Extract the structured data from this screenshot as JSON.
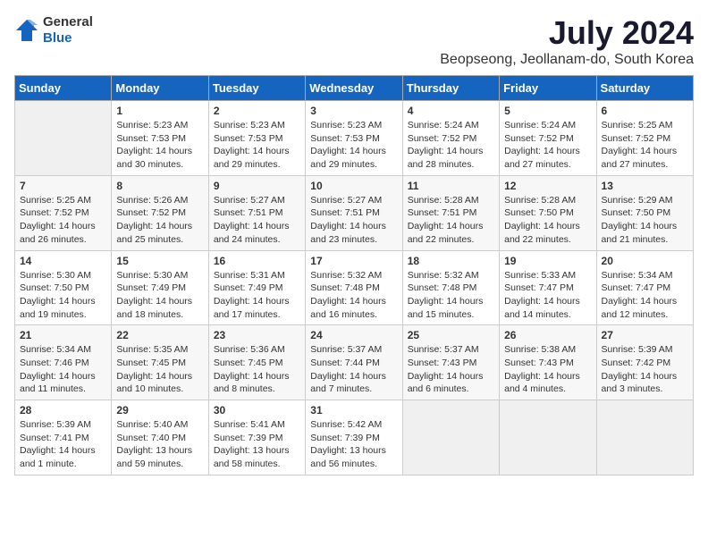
{
  "header": {
    "logo_general": "General",
    "logo_blue": "Blue",
    "month_title": "July 2024",
    "subtitle": "Beopseong, Jeollanam-do, South Korea"
  },
  "calendar": {
    "days_of_week": [
      "Sunday",
      "Monday",
      "Tuesday",
      "Wednesday",
      "Thursday",
      "Friday",
      "Saturday"
    ],
    "weeks": [
      [
        {
          "num": "",
          "info": ""
        },
        {
          "num": "1",
          "info": "Sunrise: 5:23 AM\nSunset: 7:53 PM\nDaylight: 14 hours\nand 30 minutes."
        },
        {
          "num": "2",
          "info": "Sunrise: 5:23 AM\nSunset: 7:53 PM\nDaylight: 14 hours\nand 29 minutes."
        },
        {
          "num": "3",
          "info": "Sunrise: 5:23 AM\nSunset: 7:53 PM\nDaylight: 14 hours\nand 29 minutes."
        },
        {
          "num": "4",
          "info": "Sunrise: 5:24 AM\nSunset: 7:52 PM\nDaylight: 14 hours\nand 28 minutes."
        },
        {
          "num": "5",
          "info": "Sunrise: 5:24 AM\nSunset: 7:52 PM\nDaylight: 14 hours\nand 27 minutes."
        },
        {
          "num": "6",
          "info": "Sunrise: 5:25 AM\nSunset: 7:52 PM\nDaylight: 14 hours\nand 27 minutes."
        }
      ],
      [
        {
          "num": "7",
          "info": "Sunrise: 5:25 AM\nSunset: 7:52 PM\nDaylight: 14 hours\nand 26 minutes."
        },
        {
          "num": "8",
          "info": "Sunrise: 5:26 AM\nSunset: 7:52 PM\nDaylight: 14 hours\nand 25 minutes."
        },
        {
          "num": "9",
          "info": "Sunrise: 5:27 AM\nSunset: 7:51 PM\nDaylight: 14 hours\nand 24 minutes."
        },
        {
          "num": "10",
          "info": "Sunrise: 5:27 AM\nSunset: 7:51 PM\nDaylight: 14 hours\nand 23 minutes."
        },
        {
          "num": "11",
          "info": "Sunrise: 5:28 AM\nSunset: 7:51 PM\nDaylight: 14 hours\nand 22 minutes."
        },
        {
          "num": "12",
          "info": "Sunrise: 5:28 AM\nSunset: 7:50 PM\nDaylight: 14 hours\nand 22 minutes."
        },
        {
          "num": "13",
          "info": "Sunrise: 5:29 AM\nSunset: 7:50 PM\nDaylight: 14 hours\nand 21 minutes."
        }
      ],
      [
        {
          "num": "14",
          "info": "Sunrise: 5:30 AM\nSunset: 7:50 PM\nDaylight: 14 hours\nand 19 minutes."
        },
        {
          "num": "15",
          "info": "Sunrise: 5:30 AM\nSunset: 7:49 PM\nDaylight: 14 hours\nand 18 minutes."
        },
        {
          "num": "16",
          "info": "Sunrise: 5:31 AM\nSunset: 7:49 PM\nDaylight: 14 hours\nand 17 minutes."
        },
        {
          "num": "17",
          "info": "Sunrise: 5:32 AM\nSunset: 7:48 PM\nDaylight: 14 hours\nand 16 minutes."
        },
        {
          "num": "18",
          "info": "Sunrise: 5:32 AM\nSunset: 7:48 PM\nDaylight: 14 hours\nand 15 minutes."
        },
        {
          "num": "19",
          "info": "Sunrise: 5:33 AM\nSunset: 7:47 PM\nDaylight: 14 hours\nand 14 minutes."
        },
        {
          "num": "20",
          "info": "Sunrise: 5:34 AM\nSunset: 7:47 PM\nDaylight: 14 hours\nand 12 minutes."
        }
      ],
      [
        {
          "num": "21",
          "info": "Sunrise: 5:34 AM\nSunset: 7:46 PM\nDaylight: 14 hours\nand 11 minutes."
        },
        {
          "num": "22",
          "info": "Sunrise: 5:35 AM\nSunset: 7:45 PM\nDaylight: 14 hours\nand 10 minutes."
        },
        {
          "num": "23",
          "info": "Sunrise: 5:36 AM\nSunset: 7:45 PM\nDaylight: 14 hours\nand 8 minutes."
        },
        {
          "num": "24",
          "info": "Sunrise: 5:37 AM\nSunset: 7:44 PM\nDaylight: 14 hours\nand 7 minutes."
        },
        {
          "num": "25",
          "info": "Sunrise: 5:37 AM\nSunset: 7:43 PM\nDaylight: 14 hours\nand 6 minutes."
        },
        {
          "num": "26",
          "info": "Sunrise: 5:38 AM\nSunset: 7:43 PM\nDaylight: 14 hours\nand 4 minutes."
        },
        {
          "num": "27",
          "info": "Sunrise: 5:39 AM\nSunset: 7:42 PM\nDaylight: 14 hours\nand 3 minutes."
        }
      ],
      [
        {
          "num": "28",
          "info": "Sunrise: 5:39 AM\nSunset: 7:41 PM\nDaylight: 14 hours\nand 1 minute."
        },
        {
          "num": "29",
          "info": "Sunrise: 5:40 AM\nSunset: 7:40 PM\nDaylight: 13 hours\nand 59 minutes."
        },
        {
          "num": "30",
          "info": "Sunrise: 5:41 AM\nSunset: 7:39 PM\nDaylight: 13 hours\nand 58 minutes."
        },
        {
          "num": "31",
          "info": "Sunrise: 5:42 AM\nSunset: 7:39 PM\nDaylight: 13 hours\nand 56 minutes."
        },
        {
          "num": "",
          "info": ""
        },
        {
          "num": "",
          "info": ""
        },
        {
          "num": "",
          "info": ""
        }
      ]
    ]
  }
}
